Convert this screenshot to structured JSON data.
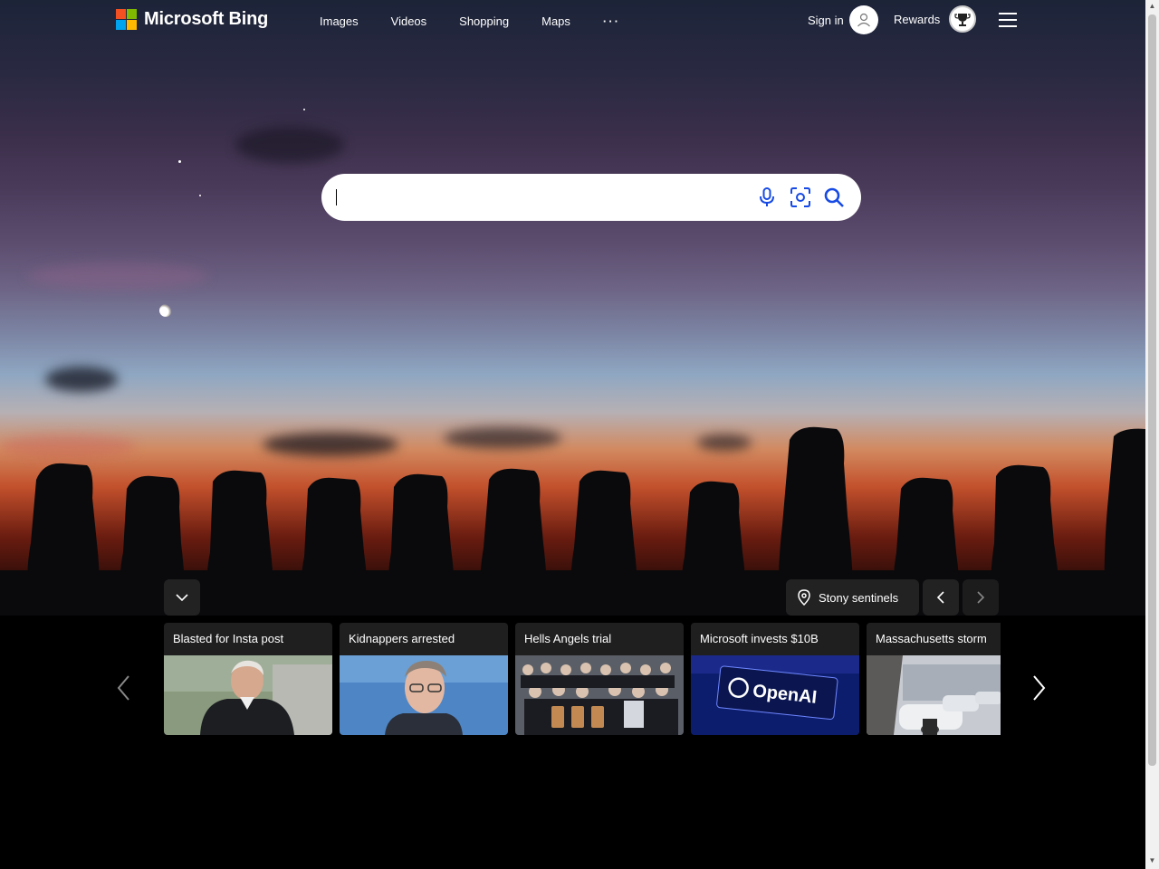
{
  "brand": {
    "name": "Microsoft Bing",
    "logo_colors": [
      "#f25022",
      "#7fba00",
      "#00a4ef",
      "#ffb900"
    ]
  },
  "nav": {
    "items": [
      "Images",
      "Videos",
      "Shopping",
      "Maps"
    ],
    "more": "···"
  },
  "account": {
    "signin_label": "Sign in",
    "rewards_label": "Rewards"
  },
  "search": {
    "value": "",
    "placeholder": "",
    "accent": "#174ae4"
  },
  "background": {
    "location_label": "Stony sentinels"
  },
  "news": {
    "cards": [
      {
        "title": "Blasted for Insta post"
      },
      {
        "title": "Kidnappers arrested"
      },
      {
        "title": "Hells Angels trial"
      },
      {
        "title": "Microsoft invests $10B"
      },
      {
        "title": "Massachusetts storm"
      }
    ],
    "openai_text": "OpenAI"
  },
  "icons": {
    "avatar": "user-icon",
    "rewards": "trophy-icon",
    "menu": "hamburger-icon",
    "voice": "microphone-icon",
    "visual": "camera-search-icon",
    "search": "search-icon",
    "location": "map-pin-icon"
  }
}
